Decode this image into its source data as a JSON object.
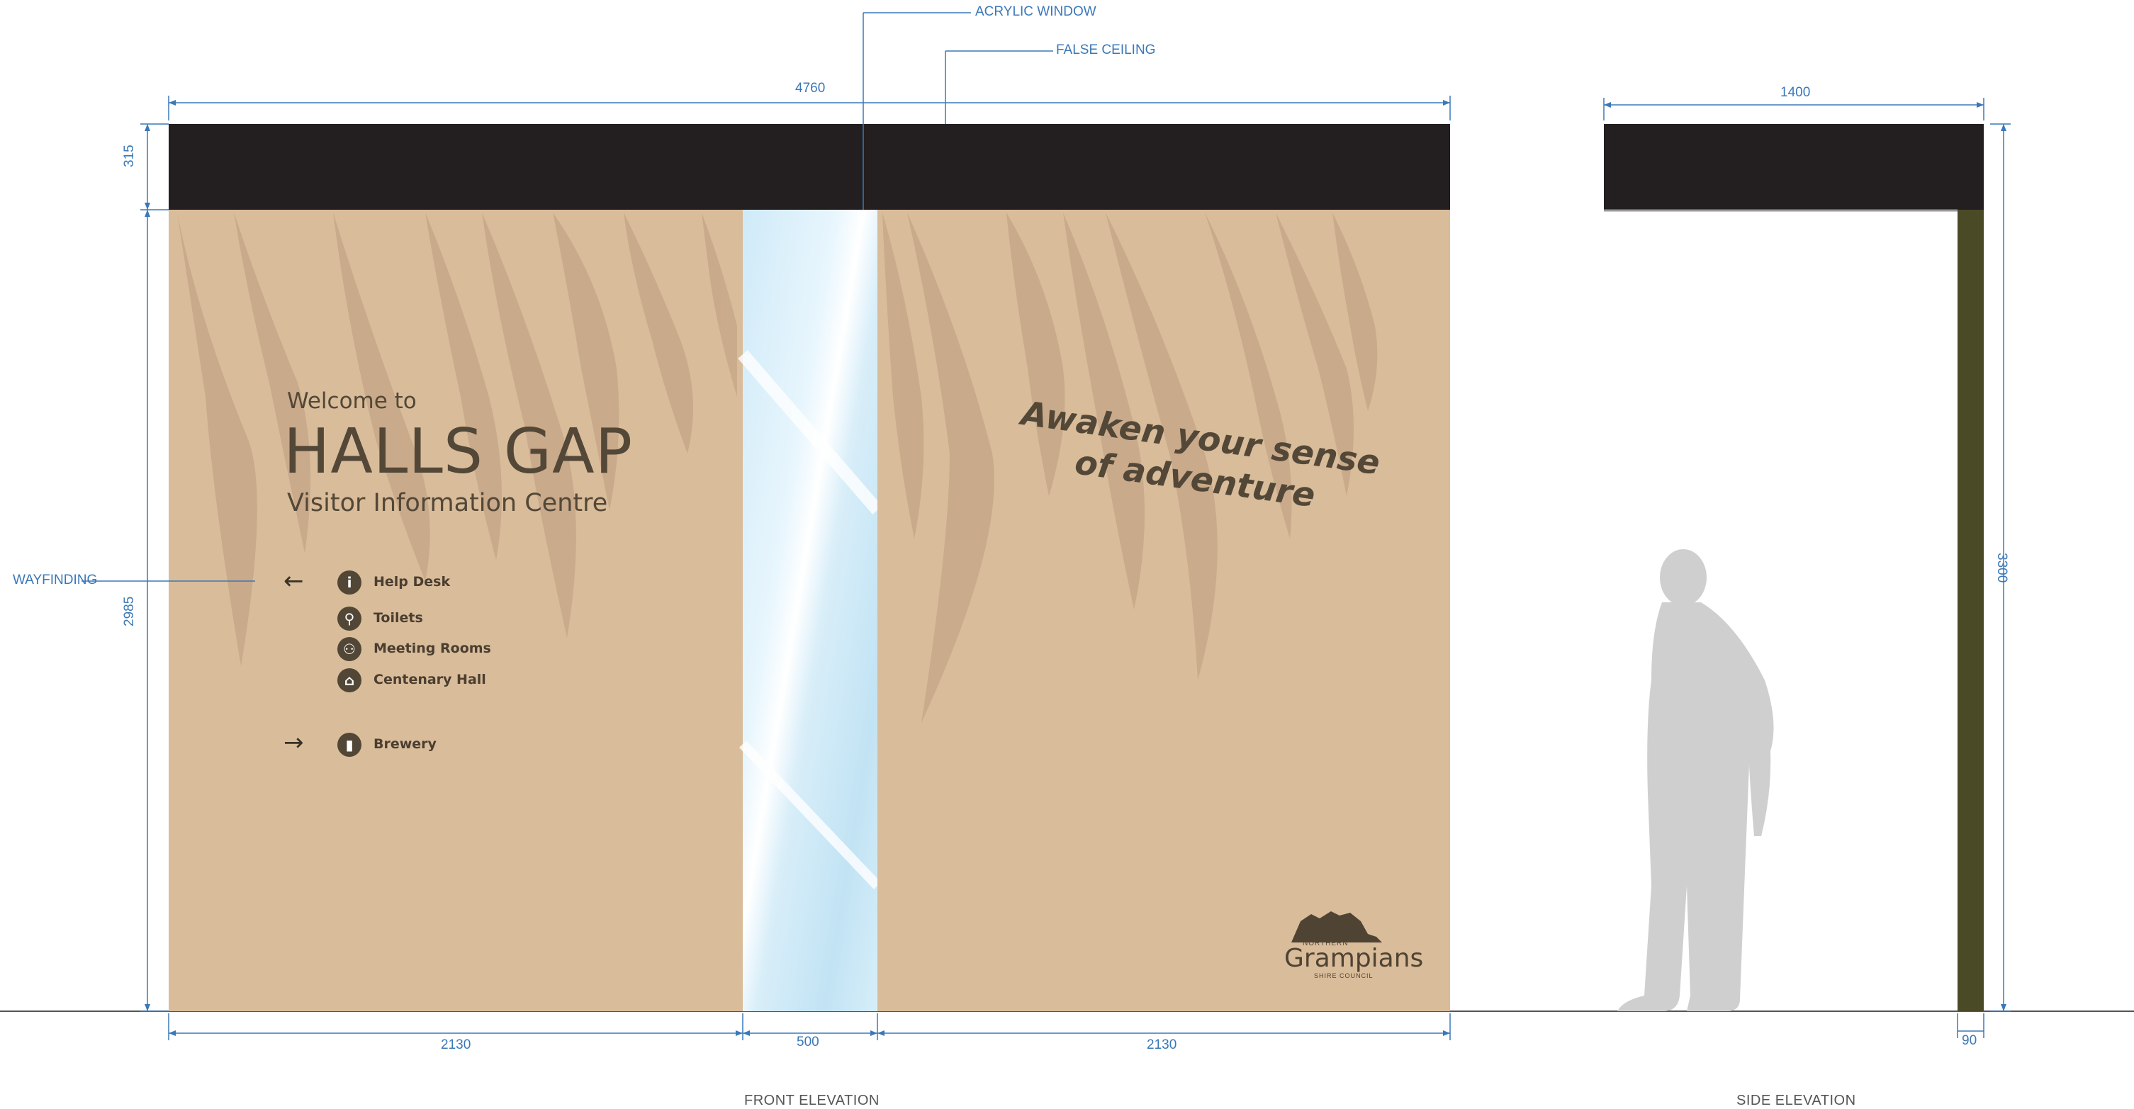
{
  "annotations": {
    "acrylic_window": "ACRYLIC WINDOW",
    "false_ceiling": "FALSE CEILING",
    "wayfinding": "WAYFINDING"
  },
  "dimensions": {
    "overall_width": "4760",
    "ceiling_height": "315",
    "panel_height": "2985",
    "left_panel_width": "2130",
    "window_width": "500",
    "right_panel_width": "2130",
    "side_width": "1400",
    "side_height": "3300",
    "side_depth": "90"
  },
  "captions": {
    "front": "FRONT ELEVATION",
    "side": "SIDE ELEVATION"
  },
  "sign": {
    "welcome": "Welcome to",
    "title": "HALLS GAP",
    "subtitle": "Visitor Information Centre",
    "wayfinding_items": [
      {
        "label": "Help Desk",
        "icon": "info-icon",
        "glyph": "i"
      },
      {
        "label": "Toilets",
        "icon": "toilets-icon",
        "glyph": "⚲"
      },
      {
        "label": "Meeting Rooms",
        "icon": "meeting-rooms-icon",
        "glyph": "⚇"
      },
      {
        "label": "Centenary Hall",
        "icon": "hall-icon",
        "glyph": "⌂"
      }
    ],
    "brewery": {
      "label": "Brewery",
      "icon": "brewery-icon",
      "glyph": "▮"
    },
    "tagline_line1": "Awaken your sense",
    "tagline_line2": "of adventure"
  },
  "logo": {
    "line1": "NORTHERN",
    "line2": "Grampians",
    "line3": "SHIRE COUNCIL"
  },
  "colors": {
    "dimension_blue": "#3a78b8",
    "ceiling_black": "#231f20",
    "panel_tan": "#d9bc9a",
    "text_brown": "#534737",
    "wall_olive": "#4a4a26",
    "acrylic_blue": "#cde9f7"
  }
}
